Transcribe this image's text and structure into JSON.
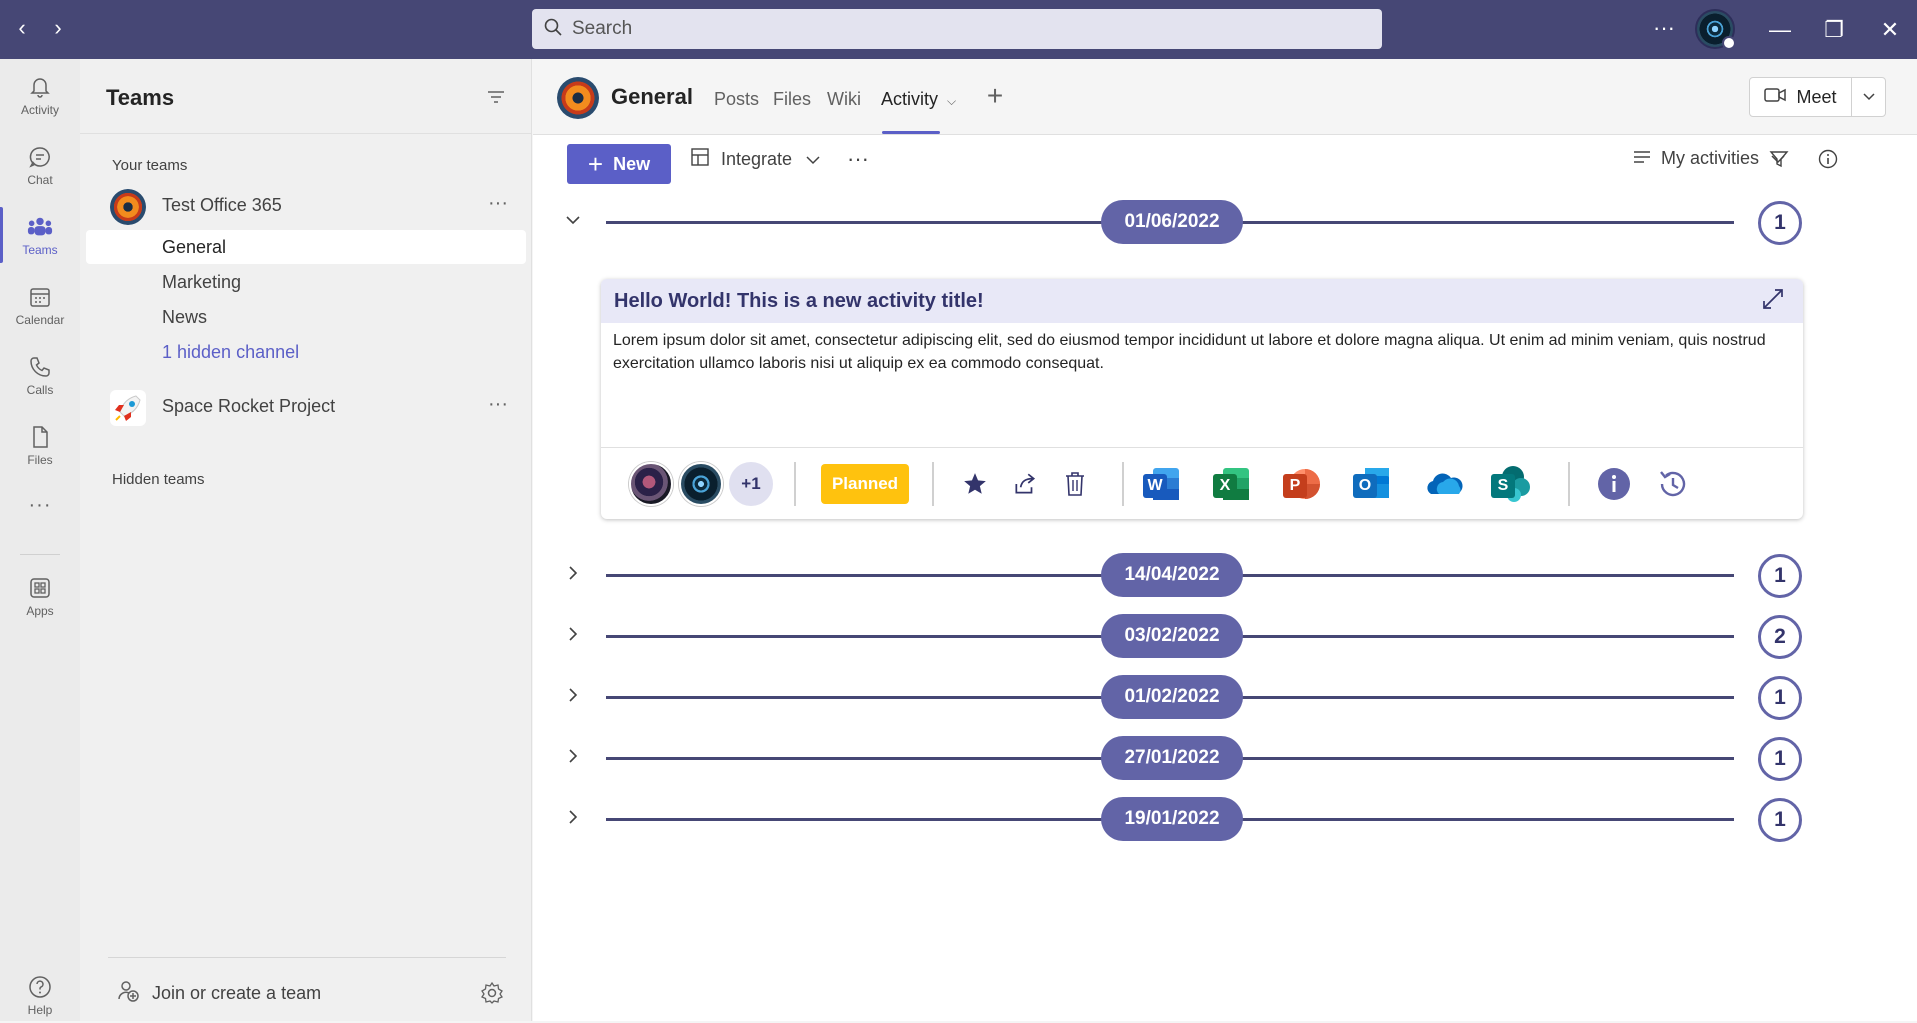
{
  "titlebar": {
    "search_placeholder": "Search",
    "more_label": "···",
    "minimize_label": "—",
    "maximize_label": "❐",
    "close_label": "✕"
  },
  "rail": {
    "items": [
      {
        "label": "Activity",
        "icon": "bell-icon"
      },
      {
        "label": "Chat",
        "icon": "chat-icon"
      },
      {
        "label": "Teams",
        "icon": "teams-icon"
      },
      {
        "label": "Calendar",
        "icon": "calendar-icon"
      },
      {
        "label": "Calls",
        "icon": "phone-icon"
      },
      {
        "label": "Files",
        "icon": "file-icon"
      },
      {
        "label": "···",
        "icon": "more-icon"
      },
      {
        "label": "Apps",
        "icon": "apps-icon"
      }
    ],
    "help_label": "Help",
    "active": "Teams"
  },
  "teams_panel": {
    "title": "Teams",
    "your_teams_label": "Your teams",
    "teams": [
      {
        "name": "Test Office 365",
        "channels": [
          "General",
          "Marketing",
          "News"
        ],
        "hidden_channel_label": "1 hidden channel"
      },
      {
        "name": "Space Rocket Project"
      }
    ],
    "hidden_teams_label": "Hidden teams",
    "join_label": "Join or create a team"
  },
  "channel": {
    "title": "General",
    "tabs": [
      "Posts",
      "Files",
      "Wiki",
      "Activity"
    ],
    "active_tab": "Activity",
    "meet_label": "Meet"
  },
  "toolbar": {
    "new_label": "New",
    "integrate_label": "Integrate",
    "more_label": "···",
    "my_activities_label": "My activities"
  },
  "timeline": [
    {
      "date": "01/06/2022",
      "count": "1",
      "expanded": true
    },
    {
      "date": "14/04/2022",
      "count": "1",
      "expanded": false
    },
    {
      "date": "03/02/2022",
      "count": "2",
      "expanded": false
    },
    {
      "date": "01/02/2022",
      "count": "1",
      "expanded": false
    },
    {
      "date": "27/01/2022",
      "count": "1",
      "expanded": false
    },
    {
      "date": "19/01/2022",
      "count": "1",
      "expanded": false
    }
  ],
  "activity_card": {
    "title": "Hello World! This is a new activity title!",
    "body": "Lorem ipsum dolor sit amet, consectetur adipiscing elit, sed do eiusmod tempor incididunt ut labore et dolore magna aliqua. Ut enim ad minim veniam, quis nostrud exercitation ullamco laboris nisi ut aliquip ex ea commodo consequat.",
    "extra_members": "+1",
    "status": "Planned",
    "status_color": "#ffc20e",
    "apps": [
      {
        "name": "Word",
        "letter": "W",
        "color": "#185abd"
      },
      {
        "name": "Excel",
        "letter": "X",
        "color": "#107c41"
      },
      {
        "name": "PowerPoint",
        "letter": "P",
        "color": "#c43e1c"
      },
      {
        "name": "Outlook",
        "letter": "O",
        "color": "#0f6cbd"
      },
      {
        "name": "OneDrive",
        "letter": "",
        "color": "#0364b8"
      },
      {
        "name": "SharePoint",
        "letter": "S",
        "color": "#03787c"
      }
    ]
  },
  "colors": {
    "titlebar": "#464775",
    "accent": "#5b5fc7",
    "timeline": "#6264a7"
  }
}
